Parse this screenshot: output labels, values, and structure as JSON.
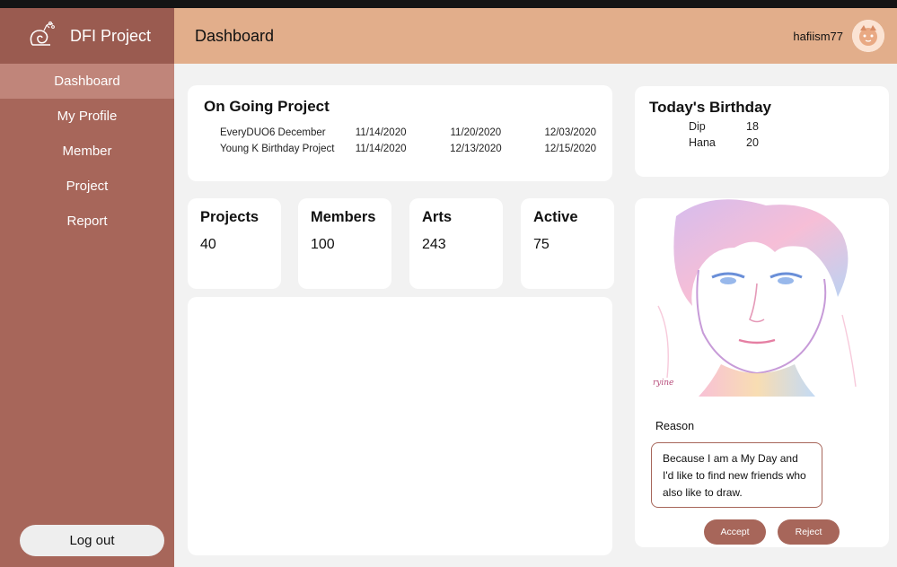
{
  "app": {
    "name": "DFI Project"
  },
  "sidebar": {
    "items": [
      {
        "label": "Dashboard"
      },
      {
        "label": "My Profile"
      },
      {
        "label": "Member"
      },
      {
        "label": "Project"
      },
      {
        "label": "Report"
      }
    ],
    "logout_label": "Log out"
  },
  "header": {
    "title": "Dashboard",
    "username": "hafiism77"
  },
  "ongoing": {
    "title": "On Going Project",
    "rows": [
      {
        "name": "EveryDUO6 December",
        "d1": "11/14/2020",
        "d2": "11/20/2020",
        "d3": "12/03/2020"
      },
      {
        "name": "Young K Birthday Project",
        "d1": "11/14/2020",
        "d2": "12/13/2020",
        "d3": "12/15/2020"
      }
    ]
  },
  "birthday": {
    "title": "Today's Birthday",
    "rows": [
      {
        "name": "Dip",
        "age": "18"
      },
      {
        "name": "Hana",
        "age": "20"
      }
    ]
  },
  "stats": [
    {
      "label": "Projects",
      "value": "40"
    },
    {
      "label": "Members",
      "value": "100"
    },
    {
      "label": "Arts",
      "value": "243"
    },
    {
      "label": "Active",
      "value": "75"
    }
  ],
  "request": {
    "reason_label": "Reason",
    "reason_text": "Because I am a My Day and I'd like to find new friends who also like to draw.",
    "accept_label": "Accept",
    "reject_label": "Reject"
  },
  "colors": {
    "sidebar": "#a7665a",
    "sidebar_active": "#c0857a",
    "header": "#e2ae8b",
    "button": "#a7665a",
    "background": "#f2f2f2"
  }
}
